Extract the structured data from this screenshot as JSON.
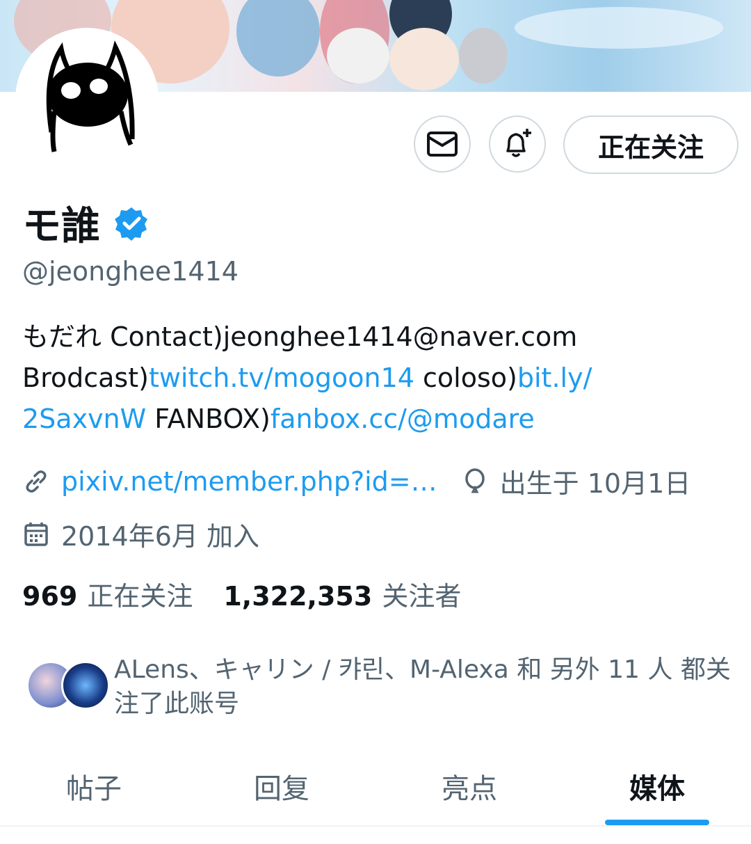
{
  "profile": {
    "name": "モ誰",
    "handle": "@jeonghee1414",
    "bio": {
      "part1": "もだれ Contact)jeonghee1414@naver.com",
      "part2": "Brodcast)",
      "link1": "twitch.tv/mogoon14",
      "part3": " coloso)",
      "link2a": "bit.ly/",
      "link2b": "2SaxvnW",
      "part4": " FANBOX)",
      "link3": "fanbox.cc/@modare"
    },
    "website": "pixiv.net/member.php?id=…",
    "birthday": "出生于 10月1日",
    "joined": "2014年6月 加入"
  },
  "actions": {
    "follow_label": "正在关注"
  },
  "counts": {
    "following_value": "969",
    "following_label": "正在关注",
    "followers_value": "1,322,353",
    "followers_label": "关注者"
  },
  "followed_by": {
    "line1": "ALens、キャリン / 캬린、M-Alexa 和 另外 11 人 都关",
    "line2": "注了此账号"
  },
  "tabs": [
    {
      "label": "帖子"
    },
    {
      "label": "回复"
    },
    {
      "label": "亮点"
    },
    {
      "label": "媒体"
    }
  ],
  "colors": {
    "accent": "#1d9bf0",
    "text_primary": "#0f1419",
    "text_secondary": "#536471",
    "border": "#cfd9de"
  },
  "icons": {
    "message": "envelope-icon",
    "notify": "bell-plus-icon",
    "verified": "verified-badge-icon",
    "website": "link-icon",
    "birthday": "balloon-icon",
    "joined": "calendar-icon"
  }
}
